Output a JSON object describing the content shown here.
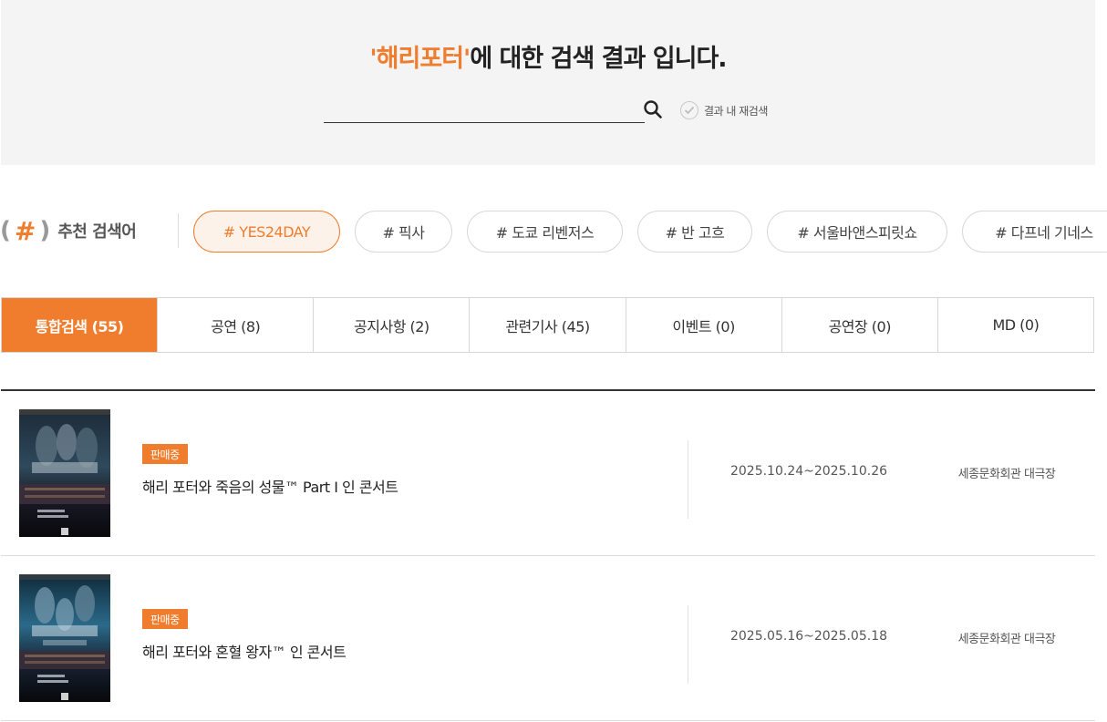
{
  "header": {
    "keyword": "'해리포터'",
    "title_suffix": "에 대한 검색 결과 입니다.",
    "search_value": "",
    "research_label": "결과 내 재검색"
  },
  "recommend": {
    "hash_open": "(",
    "hash_symbol": "#",
    "hash_close": ")",
    "title": "추천 검색어",
    "tags": [
      {
        "label": "# YES24DAY",
        "active": true
      },
      {
        "label": "# 픽사",
        "active": false
      },
      {
        "label": "# 도쿄 리벤저스",
        "active": false
      },
      {
        "label": "# 반 고흐",
        "active": false
      },
      {
        "label": "# 서울바앤스피릿쇼",
        "active": false
      },
      {
        "label": "# 다프네 기네스",
        "active": false
      }
    ]
  },
  "tabs": [
    {
      "label": "통합검색 (55)",
      "active": true
    },
    {
      "label": "공연 (8)",
      "active": false
    },
    {
      "label": "공지사항 (2)",
      "active": false
    },
    {
      "label": "관련기사 (45)",
      "active": false
    },
    {
      "label": "이벤트 (0)",
      "active": false
    },
    {
      "label": "공연장 (0)",
      "active": false
    },
    {
      "label": "MD (0)",
      "active": false
    }
  ],
  "results": [
    {
      "status": "판매중",
      "title": "해리 포터와 죽음의 성물™ Part I 인 콘서트",
      "date": "2025.10.24~2025.10.26",
      "venue": "세종문화회관 대극장"
    },
    {
      "status": "판매중",
      "title": "해리 포터와 혼혈 왕자™ 인 콘서트",
      "date": "2025.05.16~2025.05.18",
      "venue": "세종문화회관 대극장"
    }
  ],
  "colors": {
    "accent": "#ef7d2d",
    "header_bg": "#f4f4f4"
  },
  "icons": {
    "search": "search-icon",
    "check": "check-icon"
  }
}
